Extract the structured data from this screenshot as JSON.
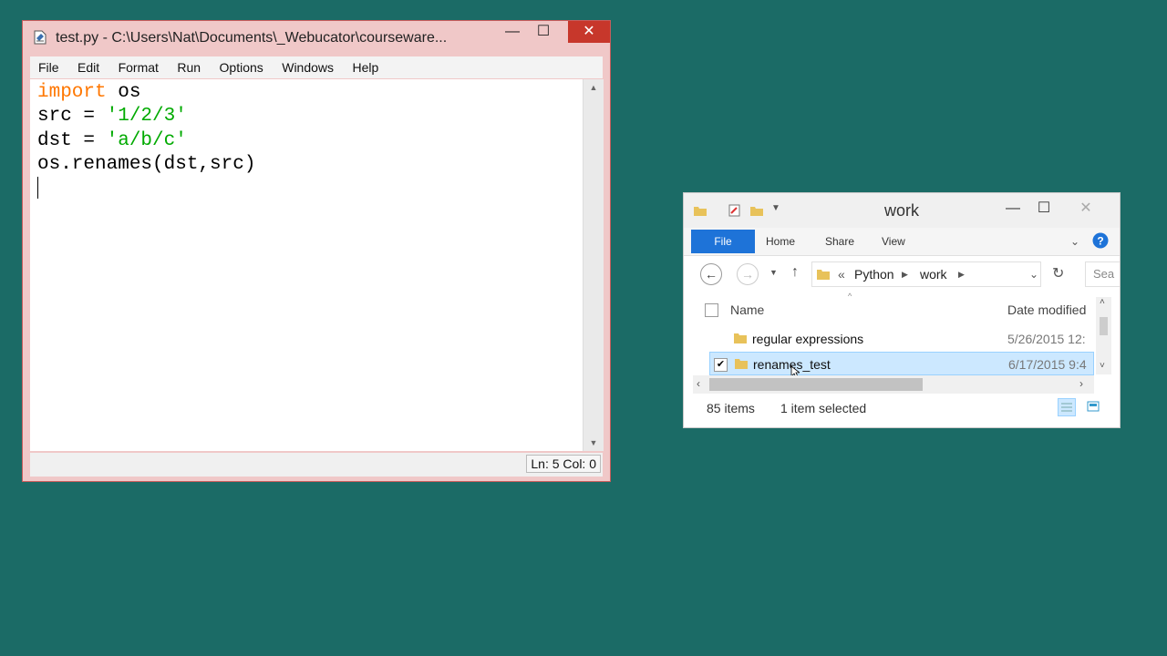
{
  "idle": {
    "title": "test.py - C:\\Users\\Nat\\Documents\\_Webucator\\courseware...",
    "window_buttons": {
      "minimize": "—",
      "maximize": "☐",
      "close": "✕"
    },
    "menu": [
      "File",
      "Edit",
      "Format",
      "Run",
      "Options",
      "Windows",
      "Help"
    ],
    "code": {
      "line1_kw": "import",
      "line1_rest": " os",
      "line2_pre": "src = ",
      "line2_str": "'1/2/3'",
      "line3_pre": "dst = ",
      "line3_str": "'a/b/c'",
      "line4": "os.renames(dst,src)"
    },
    "status": "Ln: 5  Col: 0"
  },
  "explorer": {
    "title": "work",
    "window_buttons": {
      "minimize": "—",
      "maximize": "☐",
      "close": "✕"
    },
    "ribbon_tabs": {
      "file": "File",
      "home": "Home",
      "share": "Share",
      "view": "View"
    },
    "address": {
      "prefix": "«",
      "crumbs": [
        "Python",
        "work"
      ]
    },
    "search_placeholder": "Sea",
    "columns": {
      "name": "Name",
      "date": "Date modified"
    },
    "rows": [
      {
        "name": "regular expressions",
        "date": "5/26/2015 12:",
        "selected": false
      },
      {
        "name": "renames_test",
        "date": "6/17/2015 9:4",
        "selected": true
      }
    ],
    "status": {
      "count": "85 items",
      "selection": "1 item selected"
    }
  },
  "colors": {
    "desktop": "#1b6b66",
    "idle_frame": "#f0c8c8",
    "keyword": "#ff7700",
    "string": "#00aa00",
    "file_tab": "#1e73d8",
    "selection": "#cce8ff"
  },
  "icons": [
    "python-idle-icon",
    "folder-icon",
    "back-arrow-icon",
    "forward-arrow-icon",
    "up-arrow-icon",
    "refresh-icon",
    "help-icon",
    "details-view-icon",
    "large-icons-view-icon"
  ]
}
